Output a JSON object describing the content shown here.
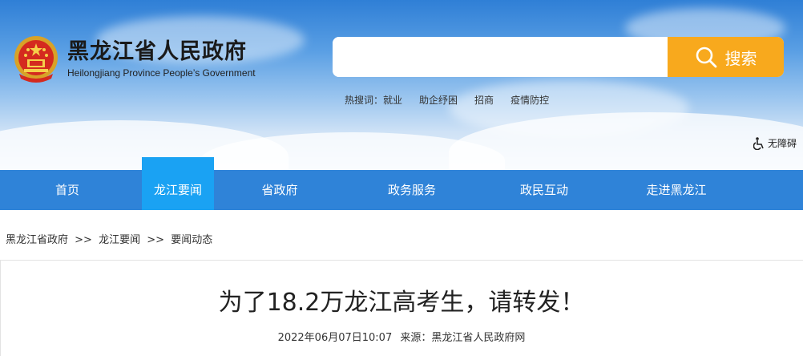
{
  "header": {
    "title_cn": "黑龙江省人民政府",
    "title_en": "Heilongjiang Province People’s Government"
  },
  "search": {
    "placeholder": "",
    "button_label": "搜索"
  },
  "hot_search": {
    "label": "热搜词：",
    "items": [
      "就业",
      "助企纾困",
      "招商",
      "疫情防控"
    ]
  },
  "accessibility": {
    "label": "无障碍"
  },
  "nav": {
    "items": [
      {
        "label": "首页"
      },
      {
        "label": "龙江要闻",
        "active": true
      },
      {
        "label": "省政府"
      },
      {
        "label": "政务服务"
      },
      {
        "label": "政民互动"
      },
      {
        "label": "走进黑龙江"
      }
    ]
  },
  "breadcrumb": {
    "items": [
      "黑龙江省政府",
      "龙江要闻",
      "要闻动态"
    ],
    "separator": ">>"
  },
  "article": {
    "title": "为了18.2万龙江高考生，请转发！",
    "date": "2022年06月07日10:07",
    "source": "来源：黑龙江省人民政府网"
  },
  "colors": {
    "nav_bg": "#2f83d8",
    "nav_active": "#1aa2f3",
    "search_button": "#f8a91d"
  }
}
